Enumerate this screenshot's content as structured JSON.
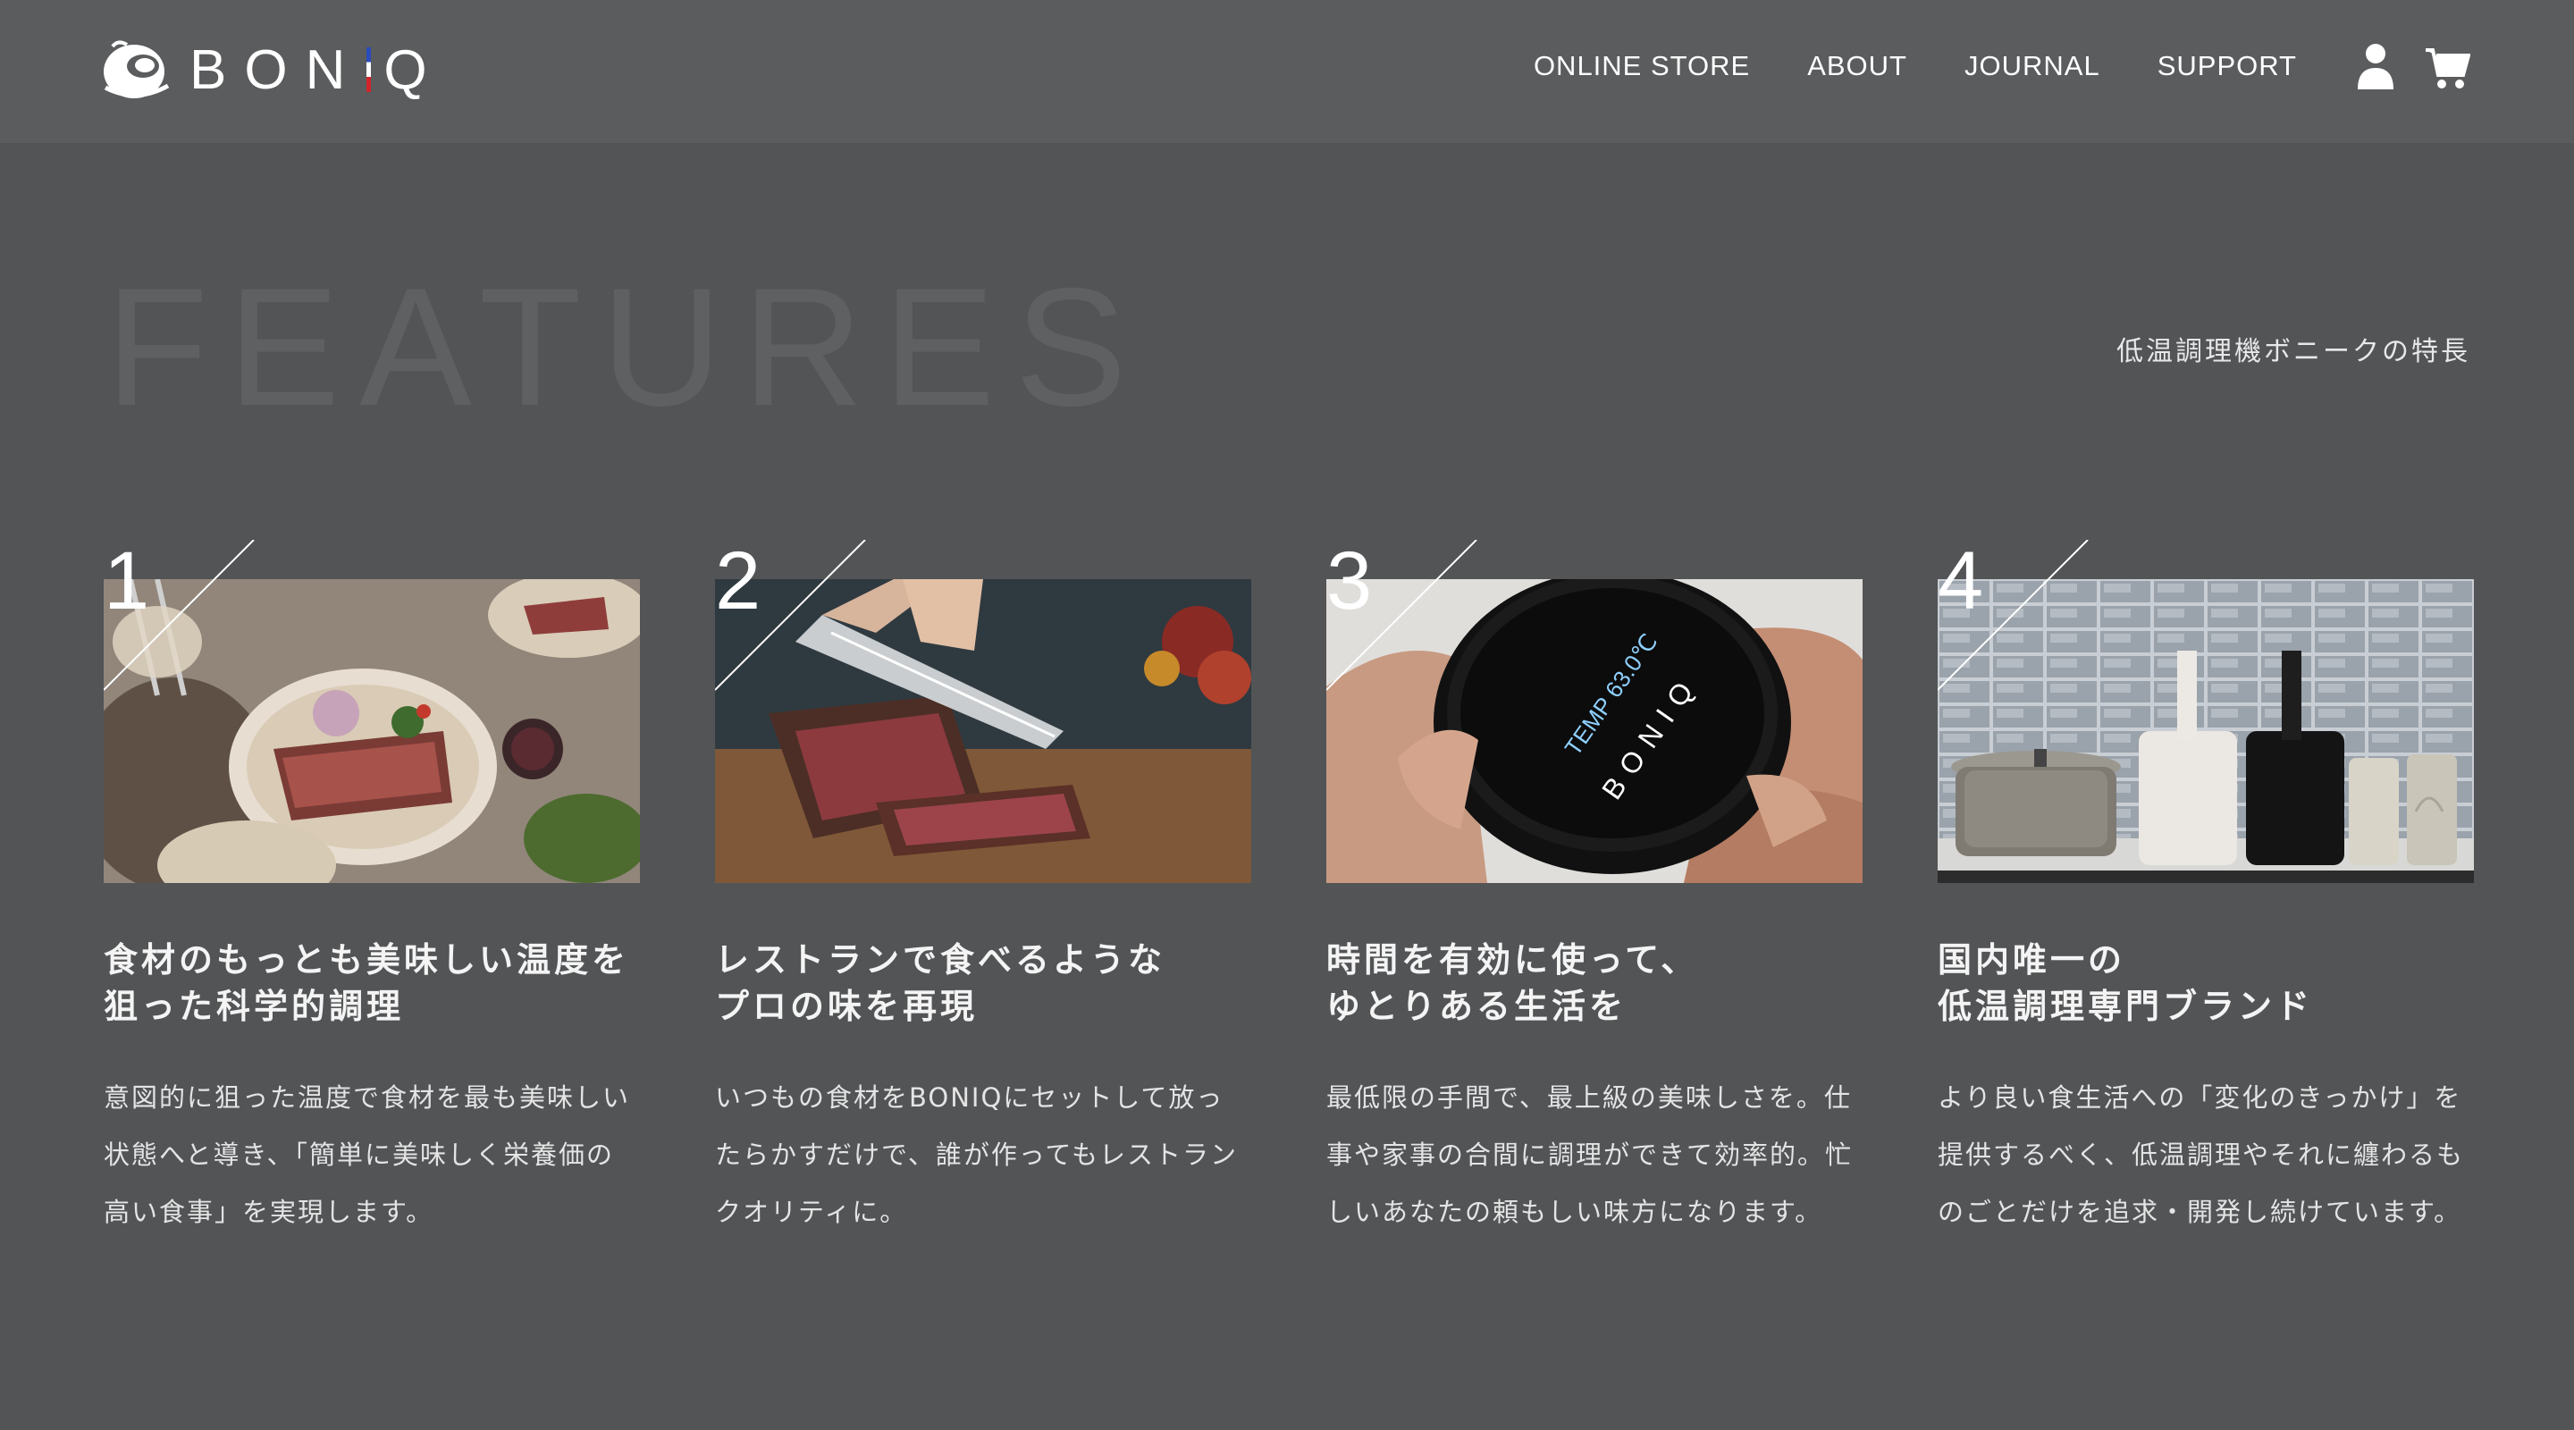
{
  "header": {
    "brand": "BONIQ",
    "nav": [
      "ONLINE STORE",
      "ABOUT",
      "JOURNAL",
      "SUPPORT"
    ],
    "icons": [
      "user-icon",
      "cart-icon"
    ]
  },
  "hero": {
    "title": "FEATURES",
    "subtitle": "低温調理機ボニークの特長"
  },
  "features": [
    {
      "number": "1",
      "image": "roast-beef-dinner-table-photo",
      "title": "食材のもっとも美味しい温度を\n狙った科学的調理",
      "description": "意図的に狙った温度で食材を最も美味しい状態へと導き、「簡単に美味しく栄養価の高い食事」を実現します。"
    },
    {
      "number": "2",
      "image": "slicing-roast-beef-photo",
      "title": "レストランで食べるような\nプロの味を再現",
      "description": "いつもの食材をBONIQにセットして放ったらかすだけで、誰が作ってもレストランクオリティに。"
    },
    {
      "number": "3",
      "image": "boniq-device-display-photo",
      "display_text": "TEMP 63.0℃",
      "device_brand": "BONIQ",
      "title": "時間を有効に使って、\nゆとりある生活を",
      "description": "最低限の手間で、最上級の美味しさを。仕事や家事の合間に調理ができて効率的。忙しいあなたの頼もしい味方になります。"
    },
    {
      "number": "4",
      "image": "boniq-product-lineup-photo",
      "title": "国内唯一の\n低温調理専門ブランド",
      "description": "より良い食生活への「変化のきっかけ」を提供するべく、低温調理やそれに纏わるものごとだけを追求・開発し続けています。"
    }
  ],
  "colors": {
    "background": "#525456",
    "header": "#5a5c5e",
    "flag_blue": "#2b4bbd",
    "flag_red": "#d3242b"
  }
}
